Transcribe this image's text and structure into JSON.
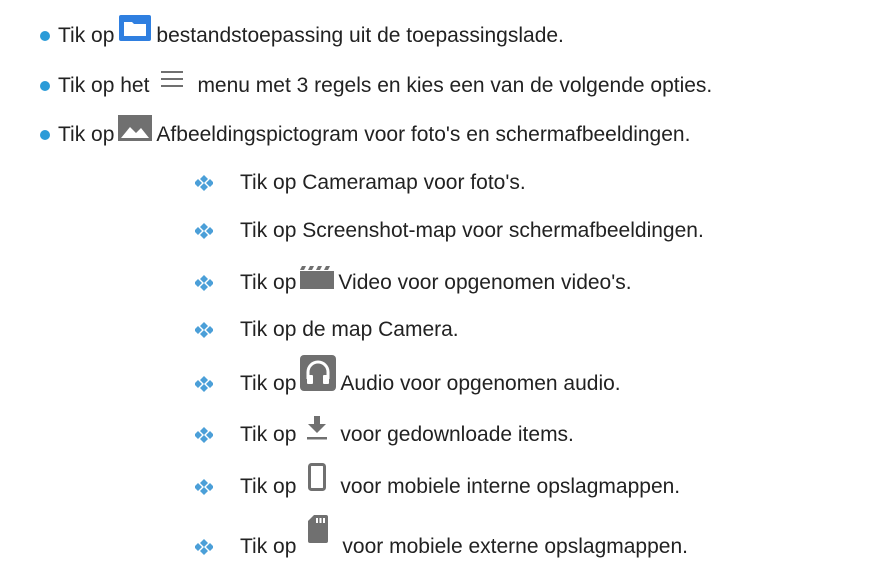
{
  "colors": {
    "bullet": "#2b9bd8",
    "diamond": "#4b9fd8",
    "text": "#222222",
    "folder_blue": "#2f7fe0",
    "icon_gray": "#707070"
  },
  "main_items": [
    {
      "pre": "Tik op",
      "icon": "folder-icon",
      "post": "bestandstoepassing uit de toepassingslade."
    },
    {
      "pre": "Tik op het",
      "icon": "hamburger-menu-icon",
      "post": "menu met 3 regels en kies een van de volgende opties."
    },
    {
      "pre": "Tik op",
      "icon": "image-icon",
      "post": "Afbeeldingspictogram voor foto's en schermafbeeldingen."
    }
  ],
  "sub_items": [
    {
      "text": "Tik op Cameramap voor foto's."
    },
    {
      "text": "Tik op Screenshot-map voor schermafbeeldingen."
    },
    {
      "pre": "Tik op",
      "icon": "video-clapper-icon",
      "post": "Video voor opgenomen video's."
    },
    {
      "text": "Tik op de map Camera."
    },
    {
      "pre": "Tik op",
      "icon": "headphones-icon",
      "post": "Audio voor opgenomen audio."
    },
    {
      "pre": "Tik op",
      "icon": "download-icon",
      "post": "voor gedownloade items."
    },
    {
      "pre": "Tik op",
      "icon": "phone-icon",
      "post": "voor mobiele interne opslagmappen."
    },
    {
      "pre": "Tik op",
      "icon": "sd-card-icon",
      "post": "voor mobiele externe opslagmappen."
    }
  ]
}
